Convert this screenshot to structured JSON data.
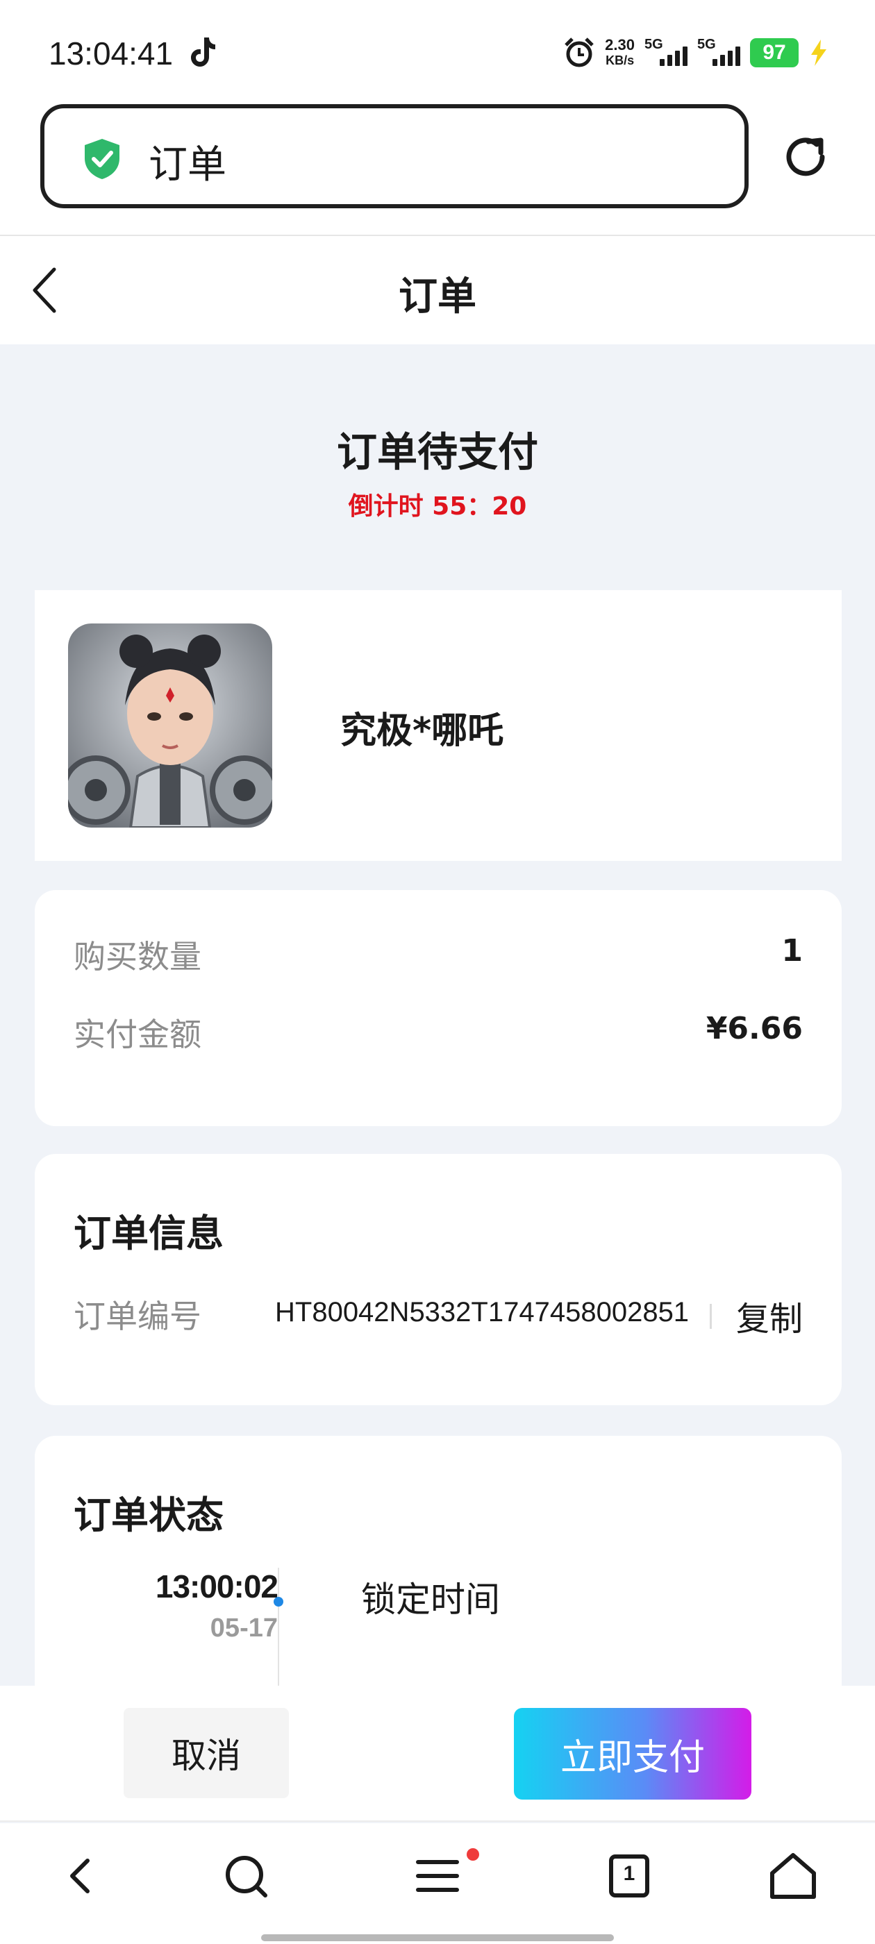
{
  "status_bar": {
    "time": "13:04:41",
    "net_speed_value": "2.30",
    "net_speed_unit": "KB/s",
    "sim1": "5G",
    "sim2": "5G",
    "battery": "97"
  },
  "address_bar": {
    "text": "订单"
  },
  "header": {
    "title": "订单"
  },
  "order": {
    "status_title": "订单待支付",
    "countdown": "倒计时 55：20",
    "product_name": "究极*哪吒",
    "quantity_label": "购买数量",
    "quantity_value": "1",
    "amount_label": "实付金额",
    "amount_value": "¥6.66"
  },
  "info": {
    "title": "订单信息",
    "order_no_label": "订单编号",
    "order_no": "HT80042N5332T1747458002851",
    "copy_label": "复制"
  },
  "status_section": {
    "title": "订单状态",
    "timeline": [
      {
        "time": "13:00:02",
        "date": "05-17",
        "label": "锁定时间"
      }
    ]
  },
  "actions": {
    "cancel_label": "取消",
    "pay_label": "立即支付"
  },
  "bottom_nav": {
    "tab_count": "1"
  },
  "colors": {
    "accent_red": "#e0141e",
    "pay_gradient_start": "#15d2f2",
    "pay_gradient_end": "#d41ce8",
    "timeline_dot": "#1e88e5",
    "battery_green": "#2fcb4f"
  }
}
